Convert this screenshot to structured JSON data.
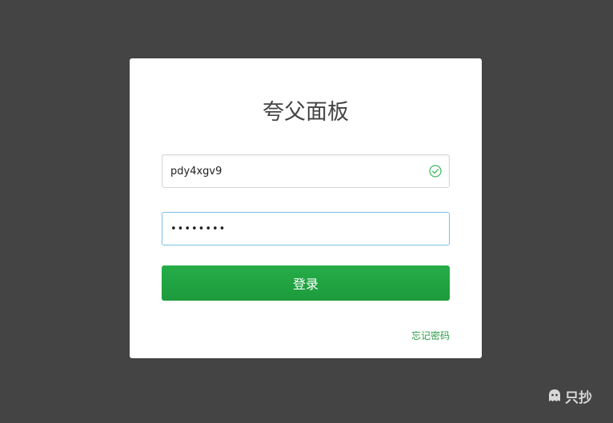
{
  "login": {
    "title": "夸父面板",
    "username_value": "pdy4xgv9",
    "password_value": "••••••••",
    "submit_label": "登录",
    "forgot_label": "忘记密码"
  },
  "icons": {
    "username_valid": "check-circle-icon",
    "watermark": "ghost-icon"
  },
  "watermark": {
    "text": "只抄"
  },
  "colors": {
    "background": "#444444",
    "card": "#ffffff",
    "accent": "#21a441",
    "focus_border": "#7cc0e8",
    "link": "#2a9b46"
  }
}
